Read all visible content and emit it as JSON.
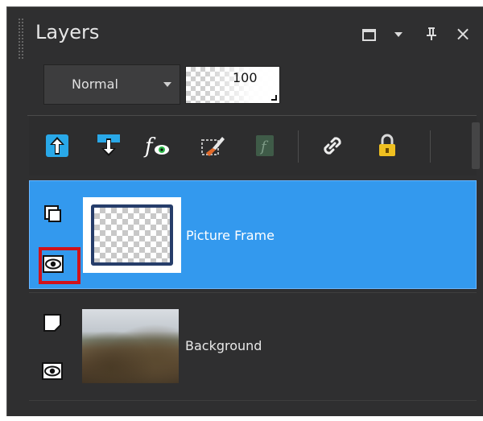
{
  "panel": {
    "title": "Layers",
    "title_buttons": [
      "maximize-icon",
      "menu-arrow-icon",
      "pin-icon",
      "close-icon"
    ],
    "close_glyph": "×",
    "pin_glyph": "ᶈ"
  },
  "blend_mode": {
    "value": "Normal"
  },
  "opacity": {
    "value": "100"
  },
  "toolbar": {
    "buttons": [
      "move-layer-up-icon",
      "move-layer-down-icon",
      "layer-effects-icon",
      "edit-mask-icon",
      "layer-style-icon",
      "link-layers-icon",
      "lock-layer-icon"
    ]
  },
  "layers": [
    {
      "name": "Picture Frame",
      "selected": true,
      "visible": true
    },
    {
      "name": "Background",
      "selected": false,
      "visible": true
    }
  ],
  "colors": {
    "panel_bg": "#2f2f30",
    "selection": "#3399ee",
    "highlight": "#d0121a",
    "accent_blue": "#29a8e8",
    "lock_gold": "#f0c020"
  }
}
